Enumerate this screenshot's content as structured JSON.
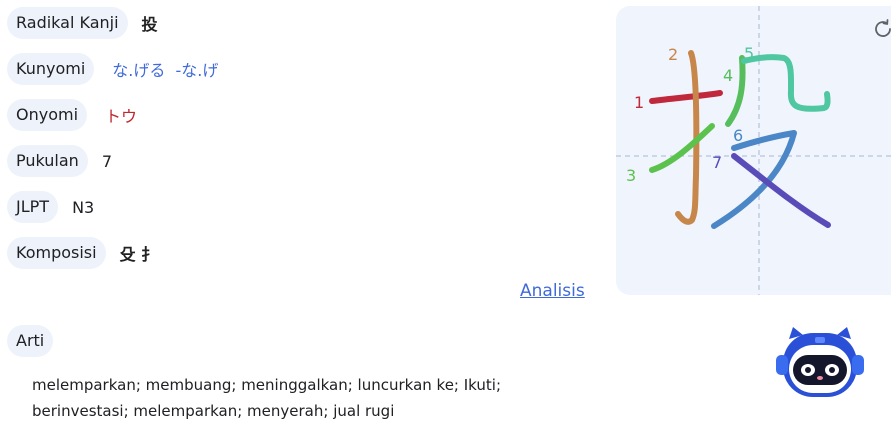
{
  "rows": [
    {
      "label": "Radikal Kanji",
      "value": "投"
    },
    {
      "label": "Kunyomi",
      "value": "な.げる  -な.げ"
    },
    {
      "label": "Onyomi",
      "value": "トウ"
    },
    {
      "label": "Pukulan",
      "value": "7"
    },
    {
      "label": "JLPT",
      "value": "N3"
    },
    {
      "label": "Komposisi",
      "value": "殳 扌"
    }
  ],
  "analysis_link": "Analisis",
  "meaning": {
    "label": "Arti",
    "text": "melemparkan; membuang; meninggalkan; luncurkan ke; Ikuti; berinvestasi; melemparkan; menyerah; jual rugi"
  },
  "stroke_order": {
    "kanji": "投",
    "stroke_numbers": [
      "1",
      "2",
      "3",
      "4",
      "5",
      "6",
      "7"
    ],
    "colors": [
      "#c0283c",
      "#c8874a",
      "#5cc24e",
      "#56be5c",
      "#4fc7a0",
      "#4b86c6",
      "#5a4cb8"
    ]
  },
  "icons": {
    "replay": "replay-icon",
    "mascot": "robot-mascot"
  }
}
